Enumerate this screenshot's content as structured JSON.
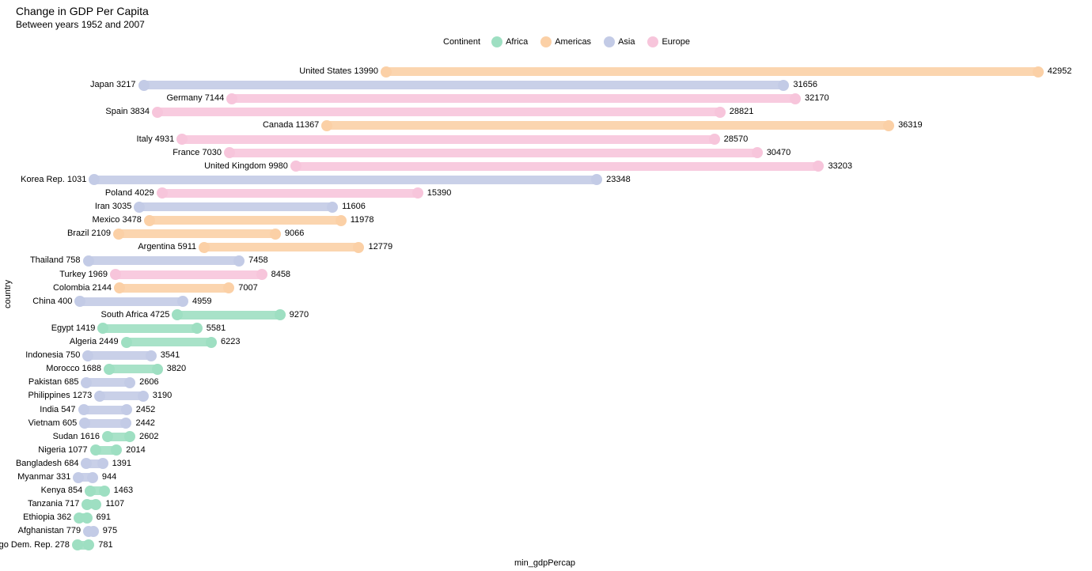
{
  "title": "Change in GDP Per Capita",
  "subtitle": "Between years 1952 and 2007",
  "legend_title": "Continent",
  "continents": [
    {
      "name": "Africa",
      "color": "#9EDFC2"
    },
    {
      "name": "Americas",
      "color": "#FBD0A6"
    },
    {
      "name": "Asia",
      "color": "#C3CBE6"
    },
    {
      "name": "Europe",
      "color": "#F7C5DB"
    }
  ],
  "ylabel": "country",
  "xlabel": "min_gdpPercap",
  "chart_data": {
    "type": "bar",
    "title": "Change in GDP Per Capita",
    "subtitle": "Between years 1952 and 2007",
    "xlabel": "min_gdpPercap",
    "ylabel": "country",
    "xlim": [
      0,
      45000
    ],
    "legend": {
      "title": "Continent",
      "position": "top",
      "entries": [
        "Africa",
        "Americas",
        "Asia",
        "Europe"
      ]
    },
    "series": [
      {
        "country": "United States",
        "continent": "Americas",
        "min": 13990,
        "max": 42952
      },
      {
        "country": "Japan",
        "continent": "Asia",
        "min": 3217,
        "max": 31656
      },
      {
        "country": "Germany",
        "continent": "Europe",
        "min": 7144,
        "max": 32170
      },
      {
        "country": "Spain",
        "continent": "Europe",
        "min": 3834,
        "max": 28821
      },
      {
        "country": "Canada",
        "continent": "Americas",
        "min": 11367,
        "max": 36319
      },
      {
        "country": "Italy",
        "continent": "Europe",
        "min": 4931,
        "max": 28570
      },
      {
        "country": "France",
        "continent": "Europe",
        "min": 7030,
        "max": 30470
      },
      {
        "country": "United Kingdom",
        "continent": "Europe",
        "min": 9980,
        "max": 33203
      },
      {
        "country": "Korea Rep.",
        "continent": "Asia",
        "min": 1031,
        "max": 23348
      },
      {
        "country": "Poland",
        "continent": "Europe",
        "min": 4029,
        "max": 15390
      },
      {
        "country": "Iran",
        "continent": "Asia",
        "min": 3035,
        "max": 11606
      },
      {
        "country": "Mexico",
        "continent": "Americas",
        "min": 3478,
        "max": 11978
      },
      {
        "country": "Brazil",
        "continent": "Americas",
        "min": 2109,
        "max": 9066
      },
      {
        "country": "Argentina",
        "continent": "Americas",
        "min": 5911,
        "max": 12779
      },
      {
        "country": "Thailand",
        "continent": "Asia",
        "min": 758,
        "max": 7458
      },
      {
        "country": "Turkey",
        "continent": "Europe",
        "min": 1969,
        "max": 8458
      },
      {
        "country": "Colombia",
        "continent": "Americas",
        "min": 2144,
        "max": 7007
      },
      {
        "country": "China",
        "continent": "Asia",
        "min": 400,
        "max": 4959
      },
      {
        "country": "South Africa",
        "continent": "Africa",
        "min": 4725,
        "max": 9270
      },
      {
        "country": "Egypt",
        "continent": "Africa",
        "min": 1419,
        "max": 5581
      },
      {
        "country": "Algeria",
        "continent": "Africa",
        "min": 2449,
        "max": 6223
      },
      {
        "country": "Indonesia",
        "continent": "Asia",
        "min": 750,
        "max": 3541
      },
      {
        "country": "Morocco",
        "continent": "Africa",
        "min": 1688,
        "max": 3820
      },
      {
        "country": "Pakistan",
        "continent": "Asia",
        "min": 685,
        "max": 2606
      },
      {
        "country": "Philippines",
        "continent": "Asia",
        "min": 1273,
        "max": 3190
      },
      {
        "country": "India",
        "continent": "Asia",
        "min": 547,
        "max": 2452
      },
      {
        "country": "Vietnam",
        "continent": "Asia",
        "min": 605,
        "max": 2442
      },
      {
        "country": "Sudan",
        "continent": "Africa",
        "min": 1616,
        "max": 2602
      },
      {
        "country": "Nigeria",
        "continent": "Africa",
        "min": 1077,
        "max": 2014
      },
      {
        "country": "Bangladesh",
        "continent": "Asia",
        "min": 684,
        "max": 1391
      },
      {
        "country": "Myanmar",
        "continent": "Asia",
        "min": 331,
        "max": 944
      },
      {
        "country": "Kenya",
        "continent": "Africa",
        "min": 854,
        "max": 1463
      },
      {
        "country": "Tanzania",
        "continent": "Africa",
        "min": 717,
        "max": 1107
      },
      {
        "country": "Ethiopia",
        "continent": "Africa",
        "min": 362,
        "max": 691
      },
      {
        "country": "Afghanistan",
        "continent": "Asia",
        "min": 779,
        "max": 975
      },
      {
        "country": "Congo Dem. Rep.",
        "continent": "Africa",
        "min": 278,
        "max": 781
      }
    ]
  }
}
